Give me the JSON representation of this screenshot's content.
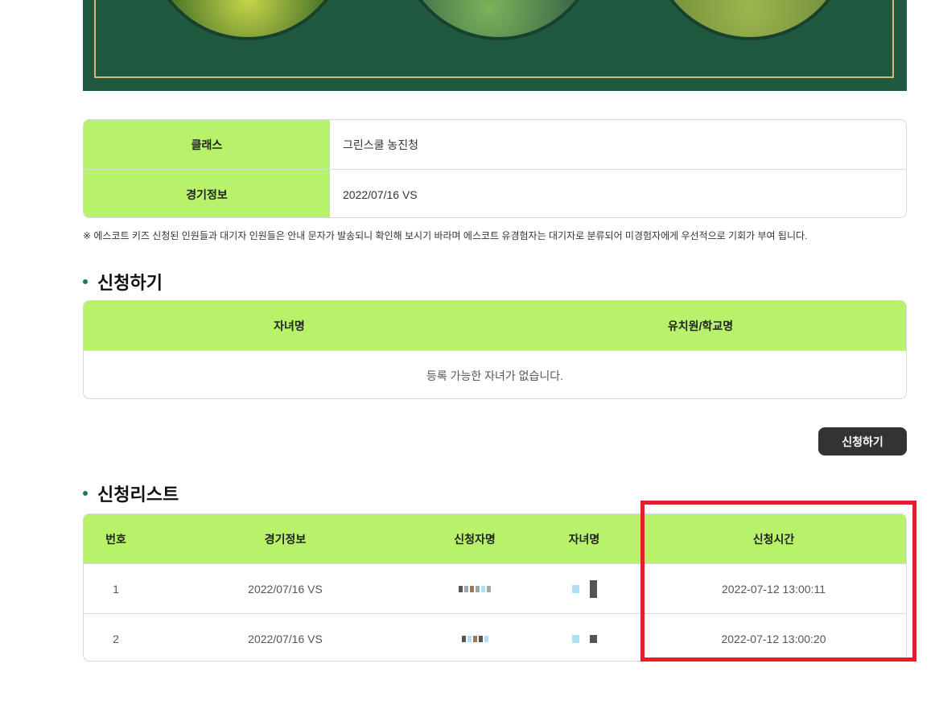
{
  "info": {
    "class_label": "클래스",
    "class_value": "그린스쿨 농진청",
    "match_label": "경기정보",
    "match_value": "2022/07/16  VS"
  },
  "notice": "※ 에스코트 키즈 신청된 인원들과 대기자 인원들은 안내 문자가 발송되니 확인해 보시기 바라며 에스코트 유경험자는 대기자로 분류되어 미경험자에게 우선적으로 기회가 부여 됩니다.",
  "apply": {
    "title": "신청하기",
    "col_child": "자녀명",
    "col_school": "유치원/학교명",
    "empty_message": "등록 가능한 자녀가 없습니다.",
    "button_label": "신청하기"
  },
  "list": {
    "title": "신청리스트",
    "headers": [
      "번호",
      "경기정보",
      "신청자명",
      "자녀명",
      "신청시간"
    ],
    "rows": [
      {
        "no": "1",
        "match": "2022/07/16 VS",
        "time": "2022-07-12 13:00:11"
      },
      {
        "no": "2",
        "match": "2022/07/16 VS",
        "time": "2022-07-12 13:00:20"
      }
    ]
  },
  "colors": {
    "header_green": "#b8f26a",
    "hero_green": "#1f5a40",
    "highlight_red": "#e3202a",
    "button_dark": "#333333"
  }
}
